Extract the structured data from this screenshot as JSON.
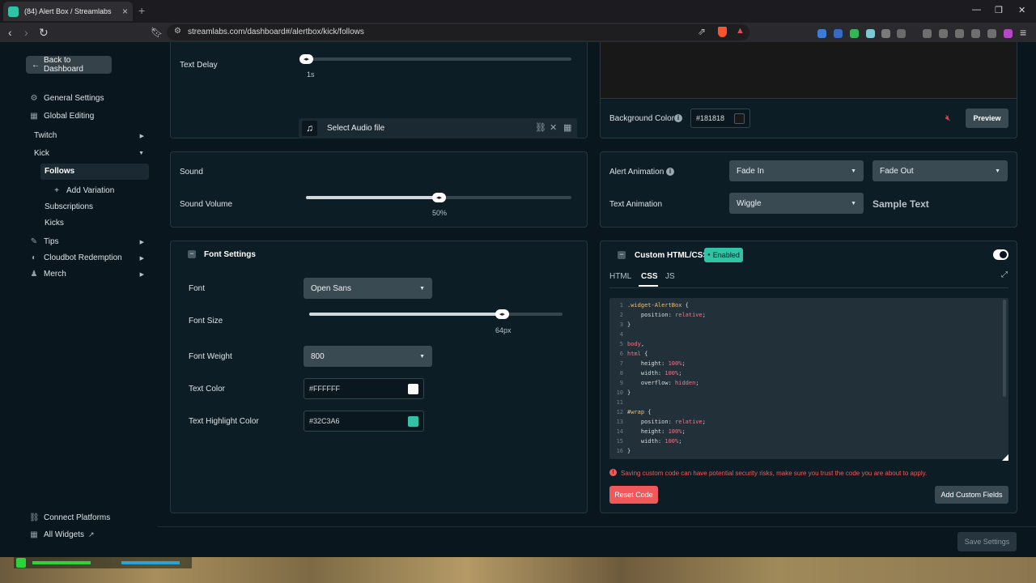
{
  "browser": {
    "tab_title": "(84) Alert Box / Streamlabs",
    "url": "streamlabs.com/dashboard#/alertbox/kick/follows"
  },
  "sidebar": {
    "back_label": "Back to Dashboard",
    "general_settings": "General Settings",
    "global_editing": "Global Editing",
    "twitch": "Twitch",
    "kick": "Kick",
    "follows": "Follows",
    "add_variation": "Add Variation",
    "subscriptions": "Subscriptions",
    "kicks": "Kicks",
    "tips": "Tips",
    "cloudbot": "Cloudbot Redemption",
    "merch": "Merch",
    "connect_platforms": "Connect Platforms",
    "all_widgets": "All Widgets"
  },
  "text_delay": {
    "label": "Text Delay",
    "value": "1s",
    "level": 0
  },
  "sound": {
    "label": "Sound",
    "select_label": "Select Audio file",
    "volume_label": "Sound Volume",
    "volume_value": "50%",
    "volume_level": 0.5
  },
  "font_settings": {
    "title": "Font Settings",
    "font_label": "Font",
    "font_value": "Open Sans",
    "size_label": "Font Size",
    "size_value": "64px",
    "size_level": 0.76,
    "weight_label": "Font Weight",
    "weight_value": "800",
    "text_color_label": "Text Color",
    "text_color_value": "#FFFFFF",
    "highlight_label": "Text Highlight Color",
    "highlight_value": "#32C3A6"
  },
  "background": {
    "label": "Background Color",
    "value": "#181818",
    "preview_label": "Preview"
  },
  "animation": {
    "alert_label": "Alert Animation",
    "alert_in": "Fade In",
    "alert_out": "Fade Out",
    "text_label": "Text Animation",
    "text_value": "Wiggle",
    "sample": "Sample Text"
  },
  "custom_code": {
    "title": "Custom HTML/CSS",
    "badge": "Enabled",
    "tabs": [
      "HTML",
      "CSS",
      "JS"
    ],
    "active_tab": "CSS",
    "warning": "Saving custom code can have potential security risks, make sure you trust the code you are about to apply.",
    "reset_label": "Reset Code",
    "add_fields_label": "Add Custom Fields"
  },
  "code_lines": [
    {
      "n": "1",
      "parts": [
        [
          "sel",
          ".widget-AlertBox"
        ],
        [
          "brace",
          " {"
        ]
      ]
    },
    {
      "n": "2",
      "parts": [
        [
          "prop",
          "    position: "
        ],
        [
          "val",
          "relative"
        ],
        [
          "prop",
          ";"
        ]
      ]
    },
    {
      "n": "3",
      "parts": [
        [
          "brace",
          "}"
        ]
      ]
    },
    {
      "n": "4",
      "parts": []
    },
    {
      "n": "5",
      "parts": [
        [
          "val",
          "body"
        ],
        [
          "prop",
          ","
        ]
      ]
    },
    {
      "n": "6",
      "parts": [
        [
          "val",
          "html"
        ],
        [
          "brace",
          " {"
        ]
      ]
    },
    {
      "n": "7",
      "parts": [
        [
          "prop",
          "    height: "
        ],
        [
          "val",
          "100%"
        ],
        [
          "prop",
          ";"
        ]
      ]
    },
    {
      "n": "8",
      "parts": [
        [
          "prop",
          "    width: "
        ],
        [
          "val",
          "100%"
        ],
        [
          "prop",
          ";"
        ]
      ]
    },
    {
      "n": "9",
      "parts": [
        [
          "prop",
          "    overflow: "
        ],
        [
          "val",
          "hidden"
        ],
        [
          "prop",
          ";"
        ]
      ]
    },
    {
      "n": "10",
      "parts": [
        [
          "brace",
          "}"
        ]
      ]
    },
    {
      "n": "11",
      "parts": []
    },
    {
      "n": "12",
      "parts": [
        [
          "sel",
          "#wrap"
        ],
        [
          "brace",
          " {"
        ]
      ]
    },
    {
      "n": "13",
      "parts": [
        [
          "prop",
          "    position: "
        ],
        [
          "val",
          "relative"
        ],
        [
          "prop",
          ";"
        ]
      ]
    },
    {
      "n": "14",
      "parts": [
        [
          "prop",
          "    height: "
        ],
        [
          "val",
          "100%"
        ],
        [
          "prop",
          ";"
        ]
      ]
    },
    {
      "n": "15",
      "parts": [
        [
          "prop",
          "    width: "
        ],
        [
          "val",
          "100%"
        ],
        [
          "prop",
          ";"
        ]
      ]
    },
    {
      "n": "16",
      "parts": [
        [
          "brace",
          "}"
        ]
      ]
    }
  ],
  "save_label": "Save Settings",
  "colors": {
    "accent": "#32C3A6",
    "danger": "#f0595a",
    "card_bg": "#0d1d25"
  }
}
